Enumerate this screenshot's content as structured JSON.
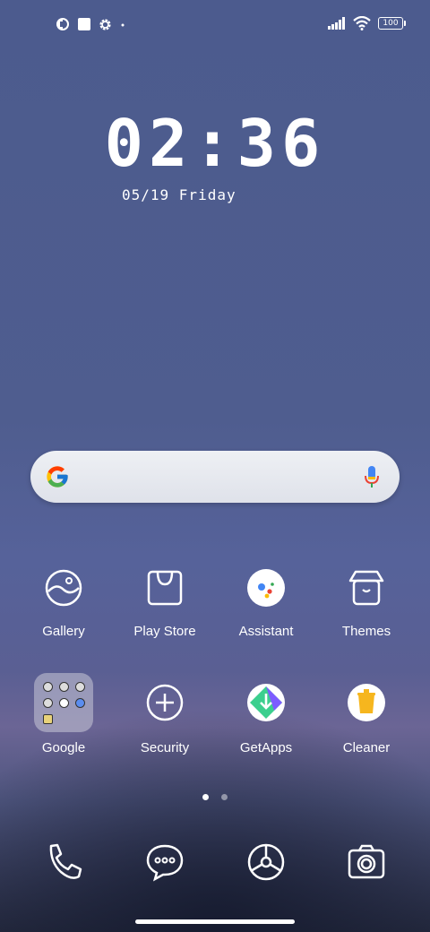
{
  "status_bar": {
    "left_icons": [
      "app-notification-icon",
      "square-notification-icon",
      "settings-notification-icon",
      "more-dot-icon"
    ],
    "battery_level": "100"
  },
  "clock": {
    "time": "02:36",
    "date": "05/19 Friday"
  },
  "search": {
    "logo": "google-logo-icon",
    "mic": "mic-icon"
  },
  "apps_row1": [
    {
      "label": "Gallery",
      "icon": "gallery-icon"
    },
    {
      "label": "Play Store",
      "icon": "play-store-icon"
    },
    {
      "label": "Assistant",
      "icon": "assistant-icon"
    },
    {
      "label": "Themes",
      "icon": "themes-icon"
    }
  ],
  "apps_row2": [
    {
      "label": "Google",
      "icon": "google-folder-icon"
    },
    {
      "label": "Security",
      "icon": "security-icon"
    },
    {
      "label": "GetApps",
      "icon": "getapps-icon"
    },
    {
      "label": "Cleaner",
      "icon": "cleaner-icon"
    }
  ],
  "dock": [
    "phone-icon",
    "messages-icon",
    "browser-icon",
    "camera-icon"
  ],
  "page_indicator": {
    "pages": 2,
    "active": 0
  },
  "colors": {
    "accent_white": "#ffffff",
    "cleaner_yellow": "#f6b61e"
  }
}
